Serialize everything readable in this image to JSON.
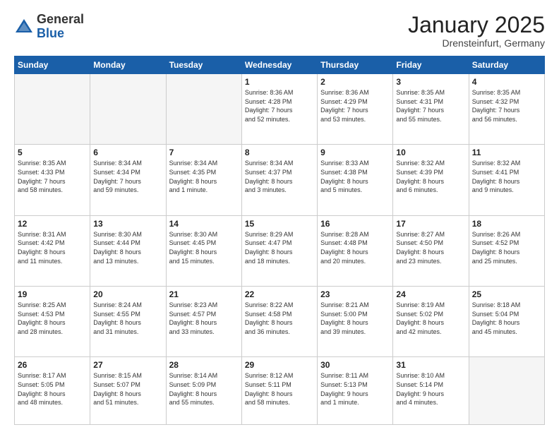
{
  "header": {
    "logo_general": "General",
    "logo_blue": "Blue",
    "month_title": "January 2025",
    "subtitle": "Drensteinfurt, Germany"
  },
  "weekdays": [
    "Sunday",
    "Monday",
    "Tuesday",
    "Wednesday",
    "Thursday",
    "Friday",
    "Saturday"
  ],
  "weeks": [
    [
      {
        "day": "",
        "info": ""
      },
      {
        "day": "",
        "info": ""
      },
      {
        "day": "",
        "info": ""
      },
      {
        "day": "1",
        "info": "Sunrise: 8:36 AM\nSunset: 4:28 PM\nDaylight: 7 hours\nand 52 minutes."
      },
      {
        "day": "2",
        "info": "Sunrise: 8:36 AM\nSunset: 4:29 PM\nDaylight: 7 hours\nand 53 minutes."
      },
      {
        "day": "3",
        "info": "Sunrise: 8:35 AM\nSunset: 4:31 PM\nDaylight: 7 hours\nand 55 minutes."
      },
      {
        "day": "4",
        "info": "Sunrise: 8:35 AM\nSunset: 4:32 PM\nDaylight: 7 hours\nand 56 minutes."
      }
    ],
    [
      {
        "day": "5",
        "info": "Sunrise: 8:35 AM\nSunset: 4:33 PM\nDaylight: 7 hours\nand 58 minutes."
      },
      {
        "day": "6",
        "info": "Sunrise: 8:34 AM\nSunset: 4:34 PM\nDaylight: 7 hours\nand 59 minutes."
      },
      {
        "day": "7",
        "info": "Sunrise: 8:34 AM\nSunset: 4:35 PM\nDaylight: 8 hours\nand 1 minute."
      },
      {
        "day": "8",
        "info": "Sunrise: 8:34 AM\nSunset: 4:37 PM\nDaylight: 8 hours\nand 3 minutes."
      },
      {
        "day": "9",
        "info": "Sunrise: 8:33 AM\nSunset: 4:38 PM\nDaylight: 8 hours\nand 5 minutes."
      },
      {
        "day": "10",
        "info": "Sunrise: 8:32 AM\nSunset: 4:39 PM\nDaylight: 8 hours\nand 6 minutes."
      },
      {
        "day": "11",
        "info": "Sunrise: 8:32 AM\nSunset: 4:41 PM\nDaylight: 8 hours\nand 9 minutes."
      }
    ],
    [
      {
        "day": "12",
        "info": "Sunrise: 8:31 AM\nSunset: 4:42 PM\nDaylight: 8 hours\nand 11 minutes."
      },
      {
        "day": "13",
        "info": "Sunrise: 8:30 AM\nSunset: 4:44 PM\nDaylight: 8 hours\nand 13 minutes."
      },
      {
        "day": "14",
        "info": "Sunrise: 8:30 AM\nSunset: 4:45 PM\nDaylight: 8 hours\nand 15 minutes."
      },
      {
        "day": "15",
        "info": "Sunrise: 8:29 AM\nSunset: 4:47 PM\nDaylight: 8 hours\nand 18 minutes."
      },
      {
        "day": "16",
        "info": "Sunrise: 8:28 AM\nSunset: 4:48 PM\nDaylight: 8 hours\nand 20 minutes."
      },
      {
        "day": "17",
        "info": "Sunrise: 8:27 AM\nSunset: 4:50 PM\nDaylight: 8 hours\nand 23 minutes."
      },
      {
        "day": "18",
        "info": "Sunrise: 8:26 AM\nSunset: 4:52 PM\nDaylight: 8 hours\nand 25 minutes."
      }
    ],
    [
      {
        "day": "19",
        "info": "Sunrise: 8:25 AM\nSunset: 4:53 PM\nDaylight: 8 hours\nand 28 minutes."
      },
      {
        "day": "20",
        "info": "Sunrise: 8:24 AM\nSunset: 4:55 PM\nDaylight: 8 hours\nand 31 minutes."
      },
      {
        "day": "21",
        "info": "Sunrise: 8:23 AM\nSunset: 4:57 PM\nDaylight: 8 hours\nand 33 minutes."
      },
      {
        "day": "22",
        "info": "Sunrise: 8:22 AM\nSunset: 4:58 PM\nDaylight: 8 hours\nand 36 minutes."
      },
      {
        "day": "23",
        "info": "Sunrise: 8:21 AM\nSunset: 5:00 PM\nDaylight: 8 hours\nand 39 minutes."
      },
      {
        "day": "24",
        "info": "Sunrise: 8:19 AM\nSunset: 5:02 PM\nDaylight: 8 hours\nand 42 minutes."
      },
      {
        "day": "25",
        "info": "Sunrise: 8:18 AM\nSunset: 5:04 PM\nDaylight: 8 hours\nand 45 minutes."
      }
    ],
    [
      {
        "day": "26",
        "info": "Sunrise: 8:17 AM\nSunset: 5:05 PM\nDaylight: 8 hours\nand 48 minutes."
      },
      {
        "day": "27",
        "info": "Sunrise: 8:15 AM\nSunset: 5:07 PM\nDaylight: 8 hours\nand 51 minutes."
      },
      {
        "day": "28",
        "info": "Sunrise: 8:14 AM\nSunset: 5:09 PM\nDaylight: 8 hours\nand 55 minutes."
      },
      {
        "day": "29",
        "info": "Sunrise: 8:12 AM\nSunset: 5:11 PM\nDaylight: 8 hours\nand 58 minutes."
      },
      {
        "day": "30",
        "info": "Sunrise: 8:11 AM\nSunset: 5:13 PM\nDaylight: 9 hours\nand 1 minute."
      },
      {
        "day": "31",
        "info": "Sunrise: 8:10 AM\nSunset: 5:14 PM\nDaylight: 9 hours\nand 4 minutes."
      },
      {
        "day": "",
        "info": ""
      }
    ]
  ]
}
